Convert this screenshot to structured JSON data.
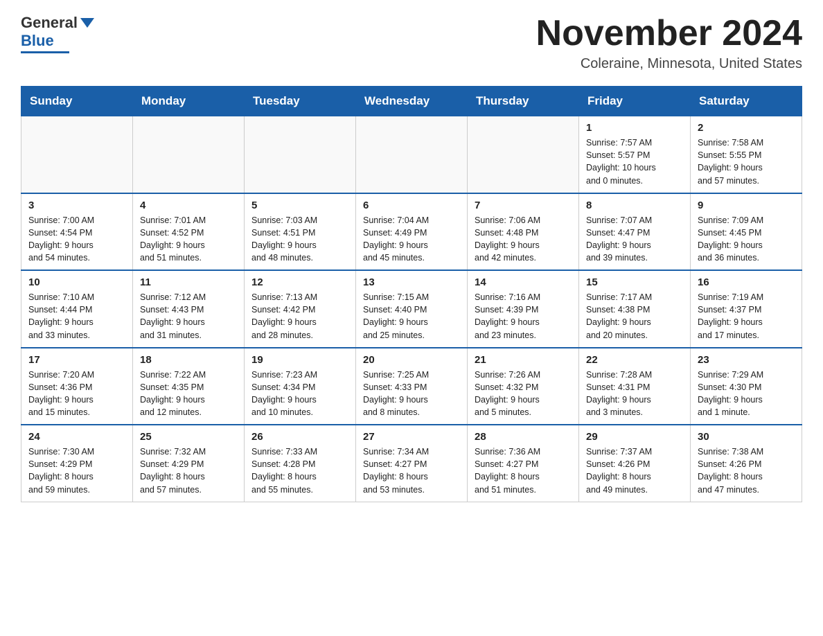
{
  "header": {
    "logo_general": "General",
    "logo_blue": "Blue",
    "month_title": "November 2024",
    "location": "Coleraine, Minnesota, United States"
  },
  "weekdays": [
    "Sunday",
    "Monday",
    "Tuesday",
    "Wednesday",
    "Thursday",
    "Friday",
    "Saturday"
  ],
  "weeks": [
    [
      {
        "day": "",
        "info": ""
      },
      {
        "day": "",
        "info": ""
      },
      {
        "day": "",
        "info": ""
      },
      {
        "day": "",
        "info": ""
      },
      {
        "day": "",
        "info": ""
      },
      {
        "day": "1",
        "info": "Sunrise: 7:57 AM\nSunset: 5:57 PM\nDaylight: 10 hours\nand 0 minutes."
      },
      {
        "day": "2",
        "info": "Sunrise: 7:58 AM\nSunset: 5:55 PM\nDaylight: 9 hours\nand 57 minutes."
      }
    ],
    [
      {
        "day": "3",
        "info": "Sunrise: 7:00 AM\nSunset: 4:54 PM\nDaylight: 9 hours\nand 54 minutes."
      },
      {
        "day": "4",
        "info": "Sunrise: 7:01 AM\nSunset: 4:52 PM\nDaylight: 9 hours\nand 51 minutes."
      },
      {
        "day": "5",
        "info": "Sunrise: 7:03 AM\nSunset: 4:51 PM\nDaylight: 9 hours\nand 48 minutes."
      },
      {
        "day": "6",
        "info": "Sunrise: 7:04 AM\nSunset: 4:49 PM\nDaylight: 9 hours\nand 45 minutes."
      },
      {
        "day": "7",
        "info": "Sunrise: 7:06 AM\nSunset: 4:48 PM\nDaylight: 9 hours\nand 42 minutes."
      },
      {
        "day": "8",
        "info": "Sunrise: 7:07 AM\nSunset: 4:47 PM\nDaylight: 9 hours\nand 39 minutes."
      },
      {
        "day": "9",
        "info": "Sunrise: 7:09 AM\nSunset: 4:45 PM\nDaylight: 9 hours\nand 36 minutes."
      }
    ],
    [
      {
        "day": "10",
        "info": "Sunrise: 7:10 AM\nSunset: 4:44 PM\nDaylight: 9 hours\nand 33 minutes."
      },
      {
        "day": "11",
        "info": "Sunrise: 7:12 AM\nSunset: 4:43 PM\nDaylight: 9 hours\nand 31 minutes."
      },
      {
        "day": "12",
        "info": "Sunrise: 7:13 AM\nSunset: 4:42 PM\nDaylight: 9 hours\nand 28 minutes."
      },
      {
        "day": "13",
        "info": "Sunrise: 7:15 AM\nSunset: 4:40 PM\nDaylight: 9 hours\nand 25 minutes."
      },
      {
        "day": "14",
        "info": "Sunrise: 7:16 AM\nSunset: 4:39 PM\nDaylight: 9 hours\nand 23 minutes."
      },
      {
        "day": "15",
        "info": "Sunrise: 7:17 AM\nSunset: 4:38 PM\nDaylight: 9 hours\nand 20 minutes."
      },
      {
        "day": "16",
        "info": "Sunrise: 7:19 AM\nSunset: 4:37 PM\nDaylight: 9 hours\nand 17 minutes."
      }
    ],
    [
      {
        "day": "17",
        "info": "Sunrise: 7:20 AM\nSunset: 4:36 PM\nDaylight: 9 hours\nand 15 minutes."
      },
      {
        "day": "18",
        "info": "Sunrise: 7:22 AM\nSunset: 4:35 PM\nDaylight: 9 hours\nand 12 minutes."
      },
      {
        "day": "19",
        "info": "Sunrise: 7:23 AM\nSunset: 4:34 PM\nDaylight: 9 hours\nand 10 minutes."
      },
      {
        "day": "20",
        "info": "Sunrise: 7:25 AM\nSunset: 4:33 PM\nDaylight: 9 hours\nand 8 minutes."
      },
      {
        "day": "21",
        "info": "Sunrise: 7:26 AM\nSunset: 4:32 PM\nDaylight: 9 hours\nand 5 minutes."
      },
      {
        "day": "22",
        "info": "Sunrise: 7:28 AM\nSunset: 4:31 PM\nDaylight: 9 hours\nand 3 minutes."
      },
      {
        "day": "23",
        "info": "Sunrise: 7:29 AM\nSunset: 4:30 PM\nDaylight: 9 hours\nand 1 minute."
      }
    ],
    [
      {
        "day": "24",
        "info": "Sunrise: 7:30 AM\nSunset: 4:29 PM\nDaylight: 8 hours\nand 59 minutes."
      },
      {
        "day": "25",
        "info": "Sunrise: 7:32 AM\nSunset: 4:29 PM\nDaylight: 8 hours\nand 57 minutes."
      },
      {
        "day": "26",
        "info": "Sunrise: 7:33 AM\nSunset: 4:28 PM\nDaylight: 8 hours\nand 55 minutes."
      },
      {
        "day": "27",
        "info": "Sunrise: 7:34 AM\nSunset: 4:27 PM\nDaylight: 8 hours\nand 53 minutes."
      },
      {
        "day": "28",
        "info": "Sunrise: 7:36 AM\nSunset: 4:27 PM\nDaylight: 8 hours\nand 51 minutes."
      },
      {
        "day": "29",
        "info": "Sunrise: 7:37 AM\nSunset: 4:26 PM\nDaylight: 8 hours\nand 49 minutes."
      },
      {
        "day": "30",
        "info": "Sunrise: 7:38 AM\nSunset: 4:26 PM\nDaylight: 8 hours\nand 47 minutes."
      }
    ]
  ]
}
